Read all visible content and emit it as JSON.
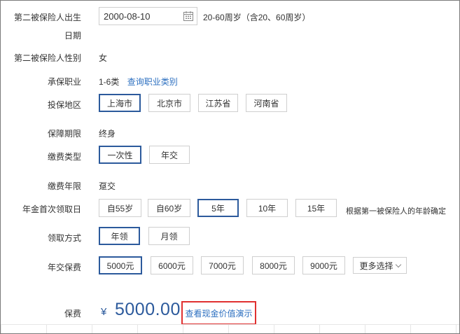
{
  "birth": {
    "label_line1": "第二被保险人出生",
    "label_line2": "日期",
    "value": "2000-08-10",
    "hint": "20-60周岁（含20、60周岁）"
  },
  "gender": {
    "label": "第二被保险人性别",
    "value": "女"
  },
  "occupation": {
    "label": "承保职业",
    "value": "1-6类",
    "link": "查询职业类别"
  },
  "region": {
    "label": "投保地区",
    "options": [
      "上海市",
      "北京市",
      "江苏省",
      "河南省"
    ],
    "selected": "上海市"
  },
  "term": {
    "label": "保障期限",
    "value": "终身"
  },
  "pay_type": {
    "label": "缴费类型",
    "options": [
      "一次性",
      "年交"
    ],
    "selected": "一次性"
  },
  "pay_years": {
    "label": "缴费年限",
    "value": "趸交"
  },
  "annuity_start": {
    "label": "年金首次领取日",
    "options": [
      "自55岁",
      "自60岁",
      "5年",
      "10年",
      "15年"
    ],
    "selected": "5年",
    "note": "根据第一被保险人的年龄确定"
  },
  "receive_mode": {
    "label": "领取方式",
    "options": [
      "年领",
      "月领"
    ],
    "selected": "年领"
  },
  "annual_premium": {
    "label": "年交保费",
    "options": [
      "5000元",
      "6000元",
      "7000元",
      "8000元",
      "9000元"
    ],
    "selected": "5000元",
    "more": "更多选择"
  },
  "premium": {
    "label": "保费",
    "currency": "¥",
    "amount": "5000.00",
    "demo_link": "查看现金价值演示"
  },
  "colors": {
    "accent": "#2c5a9c",
    "link": "#2c6fc0",
    "highlight": "#e03030"
  }
}
